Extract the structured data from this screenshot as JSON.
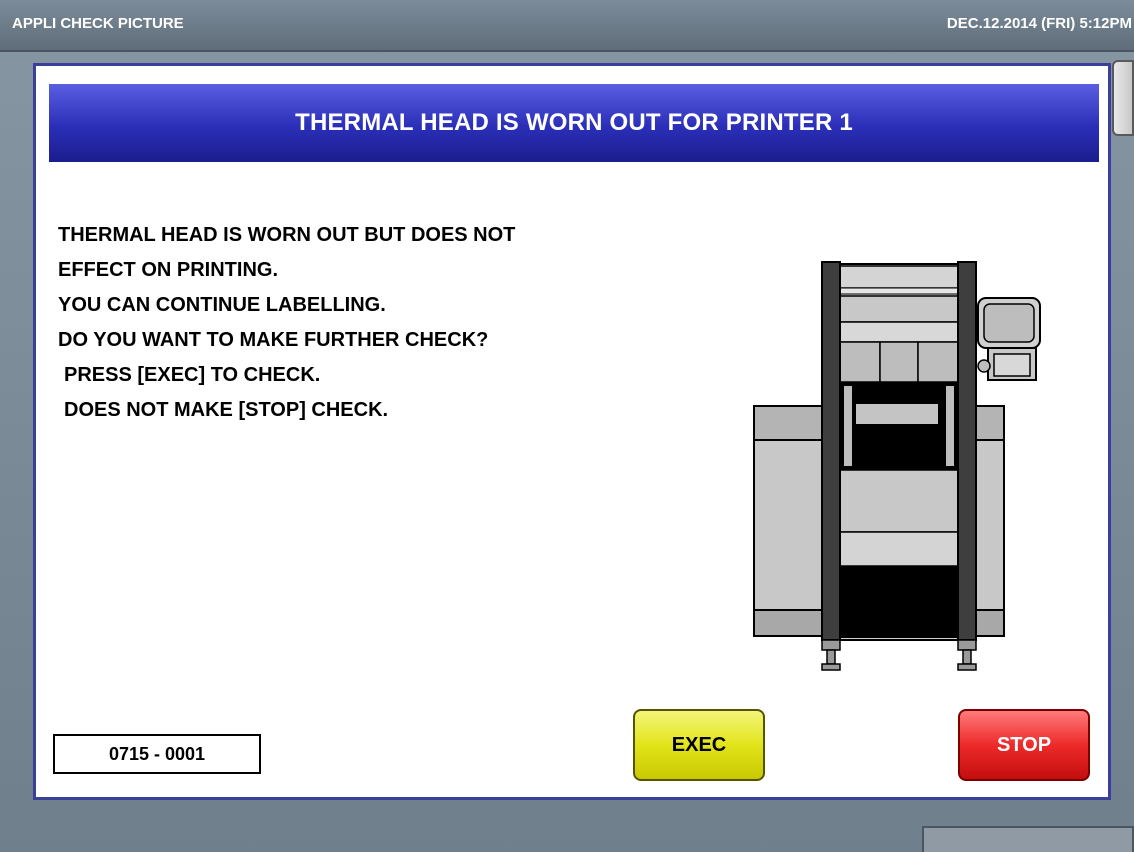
{
  "topbar": {
    "title": "APPLI CHECK PICTURE",
    "datetime": "DEC.12.2014 (FRI)  5:12PM"
  },
  "dialog": {
    "header": "THERMAL HEAD IS WORN OUT FOR PRINTER 1",
    "message_lines": [
      "THERMAL HEAD IS WORN OUT BUT DOES NOT",
      "EFFECT ON PRINTING.",
      "YOU CAN CONTINUE LABELLING.",
      "DO YOU WANT TO MAKE FURTHER CHECK?",
      " PRESS [EXEC] TO CHECK.",
      " DOES NOT MAKE [STOP] CHECK."
    ],
    "code": "0715 - 0001",
    "exec_label": "EXEC",
    "stop_label": "STOP",
    "illustration_icon": "labeling-machine-icon"
  },
  "colors": {
    "header_blue": "#2b2fb8",
    "exec_yellow": "#e2e41a",
    "stop_red": "#ee2a2a",
    "background": "#7a8a96"
  }
}
